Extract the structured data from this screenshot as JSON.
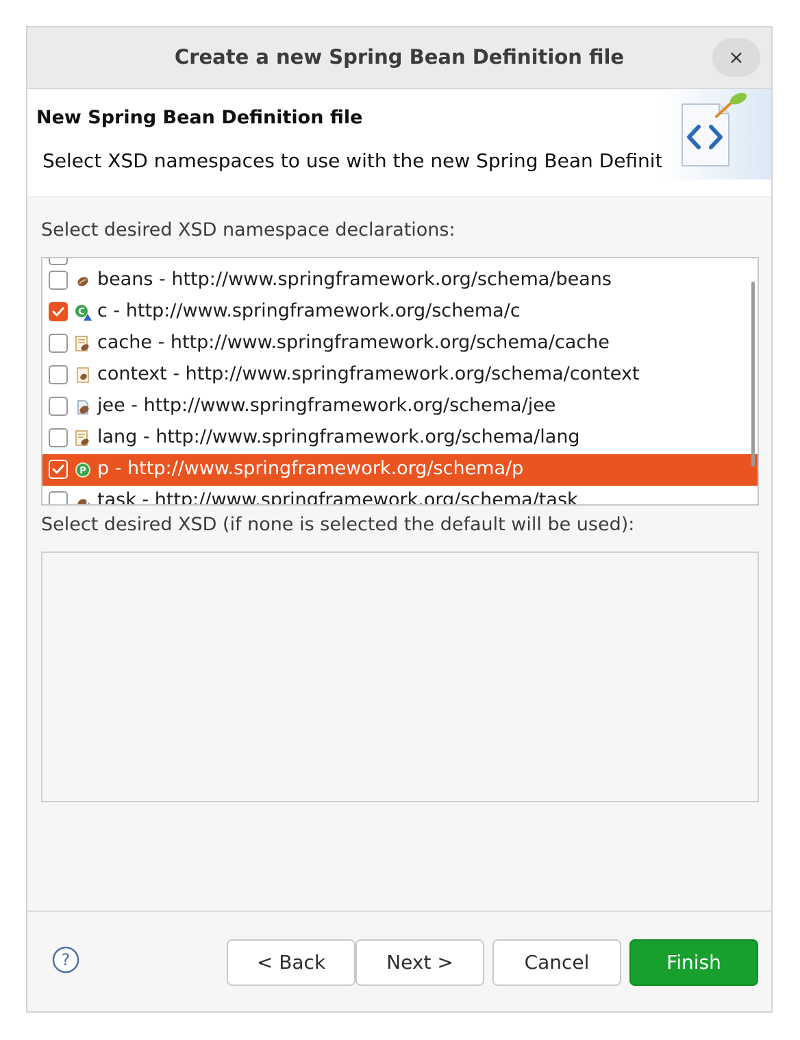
{
  "window": {
    "title": "Create a new Spring Bean Definition file",
    "close_symbol": "×"
  },
  "banner": {
    "title": "New Spring Bean Definition file",
    "description": "Select XSD namespaces to use with the new Spring Bean Definition"
  },
  "namespaces": {
    "label": "Select desired XSD namespace declarations:",
    "items": [
      {
        "label": "beans - http://www.springframework.org/schema/beans",
        "checked": false,
        "selected": false,
        "icon": "bean-icon"
      },
      {
        "label": "c - http://www.springframework.org/schema/c",
        "checked": true,
        "selected": false,
        "icon": "c-namespace-icon"
      },
      {
        "label": "cache - http://www.springframework.org/schema/cache",
        "checked": false,
        "selected": false,
        "icon": "cache-icon"
      },
      {
        "label": "context - http://www.springframework.org/schema/context",
        "checked": false,
        "selected": false,
        "icon": "context-icon"
      },
      {
        "label": "jee - http://www.springframework.org/schema/jee",
        "checked": false,
        "selected": false,
        "icon": "jee-icon"
      },
      {
        "label": "lang - http://www.springframework.org/schema/lang",
        "checked": false,
        "selected": false,
        "icon": "lang-icon"
      },
      {
        "label": "p - http://www.springframework.org/schema/p",
        "checked": true,
        "selected": true,
        "icon": "p-namespace-icon"
      },
      {
        "label": "task - http://www.springframework.org/schema/task",
        "checked": false,
        "selected": false,
        "icon": "task-icon"
      }
    ]
  },
  "xsd": {
    "label": "Select desired XSD (if none is selected the default will be used):"
  },
  "buttons": {
    "back": "< Back",
    "next": "Next >",
    "cancel": "Cancel",
    "finish": "Finish"
  },
  "colors": {
    "accent": "#e95420",
    "finish": "#18a02e"
  }
}
